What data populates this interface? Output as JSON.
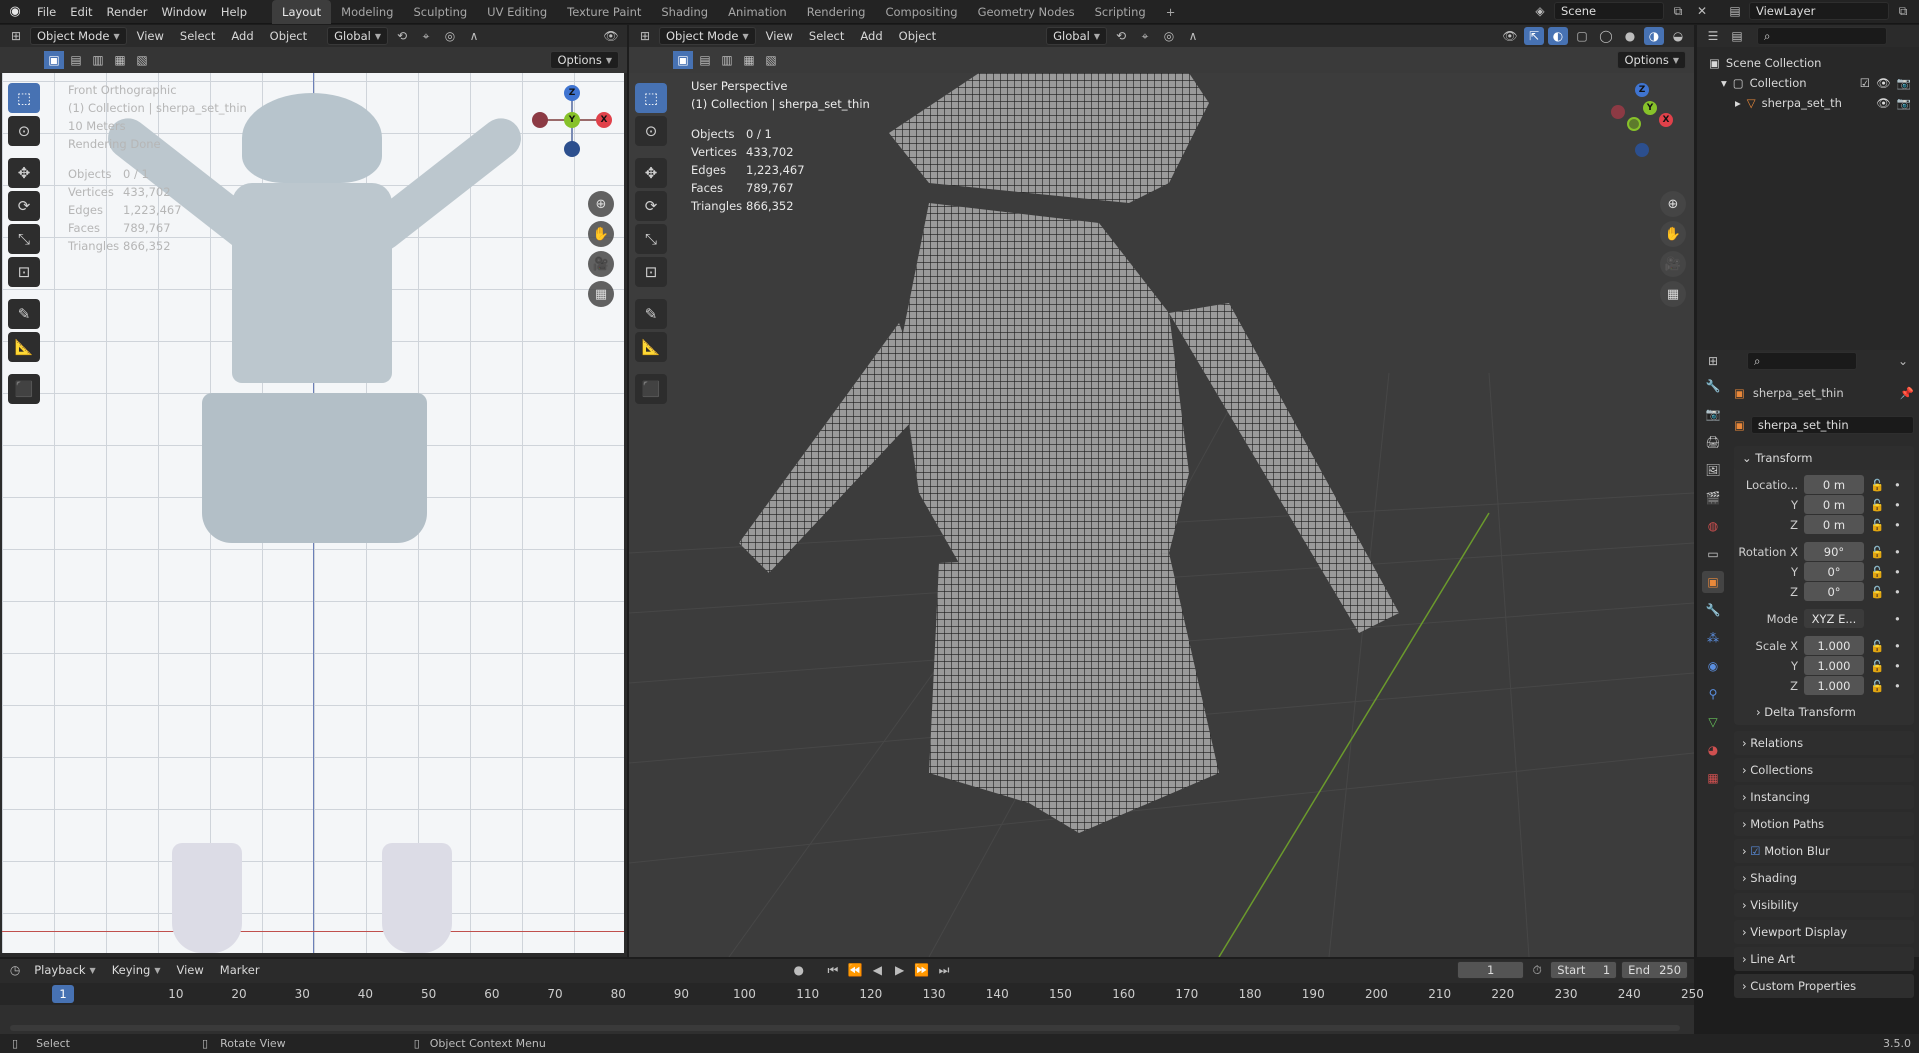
{
  "app": {
    "logo": "blender-logo"
  },
  "menu": [
    "File",
    "Edit",
    "Render",
    "Window",
    "Help"
  ],
  "workspaces": [
    "Layout",
    "Modeling",
    "Sculpting",
    "UV Editing",
    "Texture Paint",
    "Shading",
    "Animation",
    "Rendering",
    "Compositing",
    "Geometry Nodes",
    "Scripting"
  ],
  "active_workspace": "Layout",
  "scene_name": "Scene",
  "view_layer": "ViewLayer",
  "left_viewport": {
    "mode": "Object Mode",
    "menus": [
      "View",
      "Select",
      "Add",
      "Object"
    ],
    "orientation": "Global",
    "options": "Options",
    "overlay": {
      "view_name": "Front Orthographic",
      "collection": "(1) Collection | sherpa_set_thin",
      "scale": "10 Meters",
      "status": "Rendering Done",
      "stats": [
        {
          "k": "Objects",
          "v": "0 / 1"
        },
        {
          "k": "Vertices",
          "v": "433,702"
        },
        {
          "k": "Edges",
          "v": "1,223,467"
        },
        {
          "k": "Faces",
          "v": "789,767"
        },
        {
          "k": "Triangles",
          "v": "866,352"
        }
      ]
    },
    "gizmo": {
      "z": "Z",
      "y": "Y",
      "x": "X"
    }
  },
  "right_viewport": {
    "mode": "Object Mode",
    "menus": [
      "View",
      "Select",
      "Add",
      "Object"
    ],
    "orientation": "Global",
    "options": "Options",
    "overlay": {
      "view_name": "User Perspective",
      "collection": "(1) Collection | sherpa_set_thin",
      "stats": [
        {
          "k": "Objects",
          "v": "0 / 1"
        },
        {
          "k": "Vertices",
          "v": "433,702"
        },
        {
          "k": "Edges",
          "v": "1,223,467"
        },
        {
          "k": "Faces",
          "v": "789,767"
        },
        {
          "k": "Triangles",
          "v": "866,352"
        }
      ]
    },
    "gizmo": {
      "z": "Z",
      "y": "Y",
      "x": "X"
    }
  },
  "outliner": {
    "scene_collection": "Scene Collection",
    "collection": "Collection",
    "object": "sherpa_set_th"
  },
  "properties": {
    "object_name": "sherpa_set_thin",
    "data_name": "sherpa_set_thin",
    "transform_label": "Transform",
    "location_label": "Locatio...",
    "location": [
      "0 m",
      "0 m",
      "0 m"
    ],
    "rotation_label": "Rotation X",
    "rotation": [
      "90°",
      "0°",
      "0°"
    ],
    "mode_label": "Mode",
    "mode_value": "XYZ E...",
    "scale_label": "Scale X",
    "scale": [
      "1.000",
      "1.000",
      "1.000"
    ],
    "axis_y": "Y",
    "axis_z": "Z",
    "delta": "Delta Transform",
    "panels": [
      "Relations",
      "Collections",
      "Instancing",
      "Motion Paths",
      "Motion Blur",
      "Shading",
      "Visibility",
      "Viewport Display",
      "Line Art",
      "Custom Properties"
    ]
  },
  "timeline": {
    "menus": [
      "Playback",
      "Keying",
      "View",
      "Marker"
    ],
    "current_frame": "1",
    "start_label": "Start",
    "start": "1",
    "end_label": "End",
    "end": "250",
    "ticks": [
      "10",
      "20",
      "30",
      "40",
      "50",
      "60",
      "70",
      "80",
      "90",
      "100",
      "110",
      "120",
      "130",
      "140",
      "150",
      "160",
      "170",
      "180",
      "190",
      "200",
      "210",
      "220",
      "230",
      "240",
      "250"
    ],
    "marker": "1"
  },
  "statusbar": {
    "select": "Select",
    "rotate": "Rotate View",
    "context": "Object Context Menu",
    "version": "3.5.0"
  }
}
